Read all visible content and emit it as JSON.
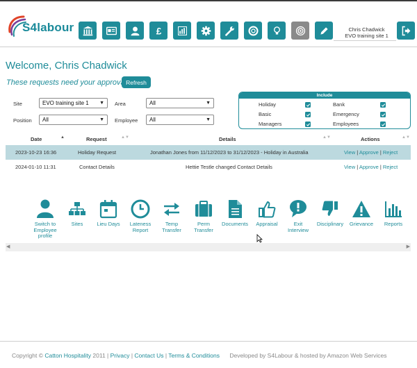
{
  "brand": {
    "name": "S4labour",
    "accent": "#1f8c99"
  },
  "toolbar": {
    "icons": [
      "bank-icon",
      "id-card-icon",
      "person-icon",
      "pound-icon",
      "bar-chart-icon",
      "gear-icon",
      "wrench-icon",
      "lifebuoy-icon",
      "lightbulb-icon",
      "target-icon",
      "pencil-icon"
    ]
  },
  "user": {
    "name": "Chris Chadwick",
    "site": "EVO training site 1"
  },
  "welcome": "Welcome, Chris Chadwick",
  "approval_prompt": "These requests need your approval:",
  "refresh_label": "Refresh",
  "filters": {
    "site_label": "Site",
    "site_value": "EVO training site 1",
    "area_label": "Area",
    "area_value": "All",
    "position_label": "Position",
    "position_value": "All",
    "employee_label": "Employee",
    "employee_value": "All"
  },
  "include": {
    "title": "Include",
    "items": [
      {
        "label": "Holiday",
        "checked": true
      },
      {
        "label": "Bank",
        "checked": true
      },
      {
        "label": "Basic",
        "checked": true
      },
      {
        "label": "Emergency",
        "checked": true
      },
      {
        "label": "Managers",
        "checked": true
      },
      {
        "label": "Employees",
        "checked": true
      }
    ]
  },
  "table": {
    "headers": [
      "Date",
      "Request",
      "Details",
      "Actions"
    ],
    "rows": [
      {
        "date": "2023-10-23 16:36",
        "request": "Holiday Request",
        "details": "Jonathan Jones from 11/12/2023 to 31/12/2023 - Holiday in Australia",
        "view": "View",
        "approve": "Approve",
        "reject": "Reject"
      },
      {
        "date": "2024-01-10 11:31",
        "request": "Contact Details",
        "details": "Hettie Testle changed Contact Details",
        "view": "View",
        "approve": "Approve",
        "reject": "Reject"
      }
    ]
  },
  "quicklinks": [
    {
      "icon": "person-icon",
      "label": "Switch to Employee profile"
    },
    {
      "icon": "sites-icon",
      "label": "Sites"
    },
    {
      "icon": "calendar-icon",
      "label": "Lieu Days"
    },
    {
      "icon": "clock-icon",
      "label": "Lateness Report"
    },
    {
      "icon": "transfer-arrows-icon",
      "label": "Temp Transfer"
    },
    {
      "icon": "briefcase-icon",
      "label": "Perm Transfer"
    },
    {
      "icon": "document-icon",
      "label": "Documents"
    },
    {
      "icon": "thumbs-up-icon",
      "label": "Appraisal"
    },
    {
      "icon": "speech-bubble-icon",
      "label": "Exit Interview"
    },
    {
      "icon": "thumbs-down-icon",
      "label": "Disciplinary"
    },
    {
      "icon": "warning-icon",
      "label": "Grievance"
    },
    {
      "icon": "reports-chart-icon",
      "label": "Reports"
    }
  ],
  "footer": {
    "copyright": "Copyright ©",
    "company": "Catton Hospitality",
    "year": "2011",
    "privacy": "Privacy",
    "contact": "Contact Us",
    "terms": "Terms & Conditions",
    "developed": "Developed by S4Labour & hosted by Amazon Web Services"
  }
}
